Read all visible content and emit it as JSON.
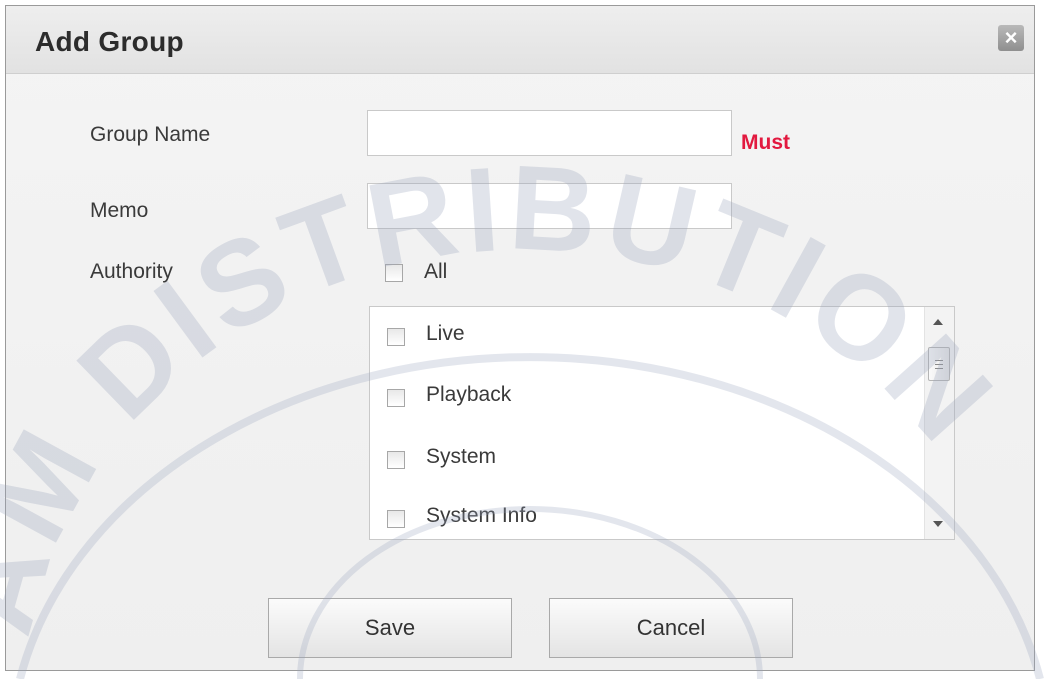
{
  "dialog": {
    "title": "Add Group",
    "close_symbol": "×"
  },
  "form": {
    "group_name": {
      "label": "Group Name",
      "value": "",
      "placeholder": "",
      "required_note": "Must"
    },
    "memo": {
      "label": "Memo",
      "value": "",
      "placeholder": ""
    },
    "authority": {
      "label": "Authority",
      "all_label": "All",
      "items": [
        {
          "label": "Live",
          "checked": false
        },
        {
          "label": "Playback",
          "checked": false
        },
        {
          "label": "System",
          "checked": false
        },
        {
          "label": "System Info",
          "checked": false
        }
      ]
    }
  },
  "buttons": {
    "save": "Save",
    "cancel": "Cancel"
  },
  "watermark_text": "AM DISTRIBUTION",
  "icons": {
    "close": "close-icon",
    "scroll_up": "chevron-up-icon",
    "scroll_down": "chevron-down-icon"
  },
  "colors": {
    "must": "#e2193f",
    "watermark": "#9aa6bd"
  }
}
